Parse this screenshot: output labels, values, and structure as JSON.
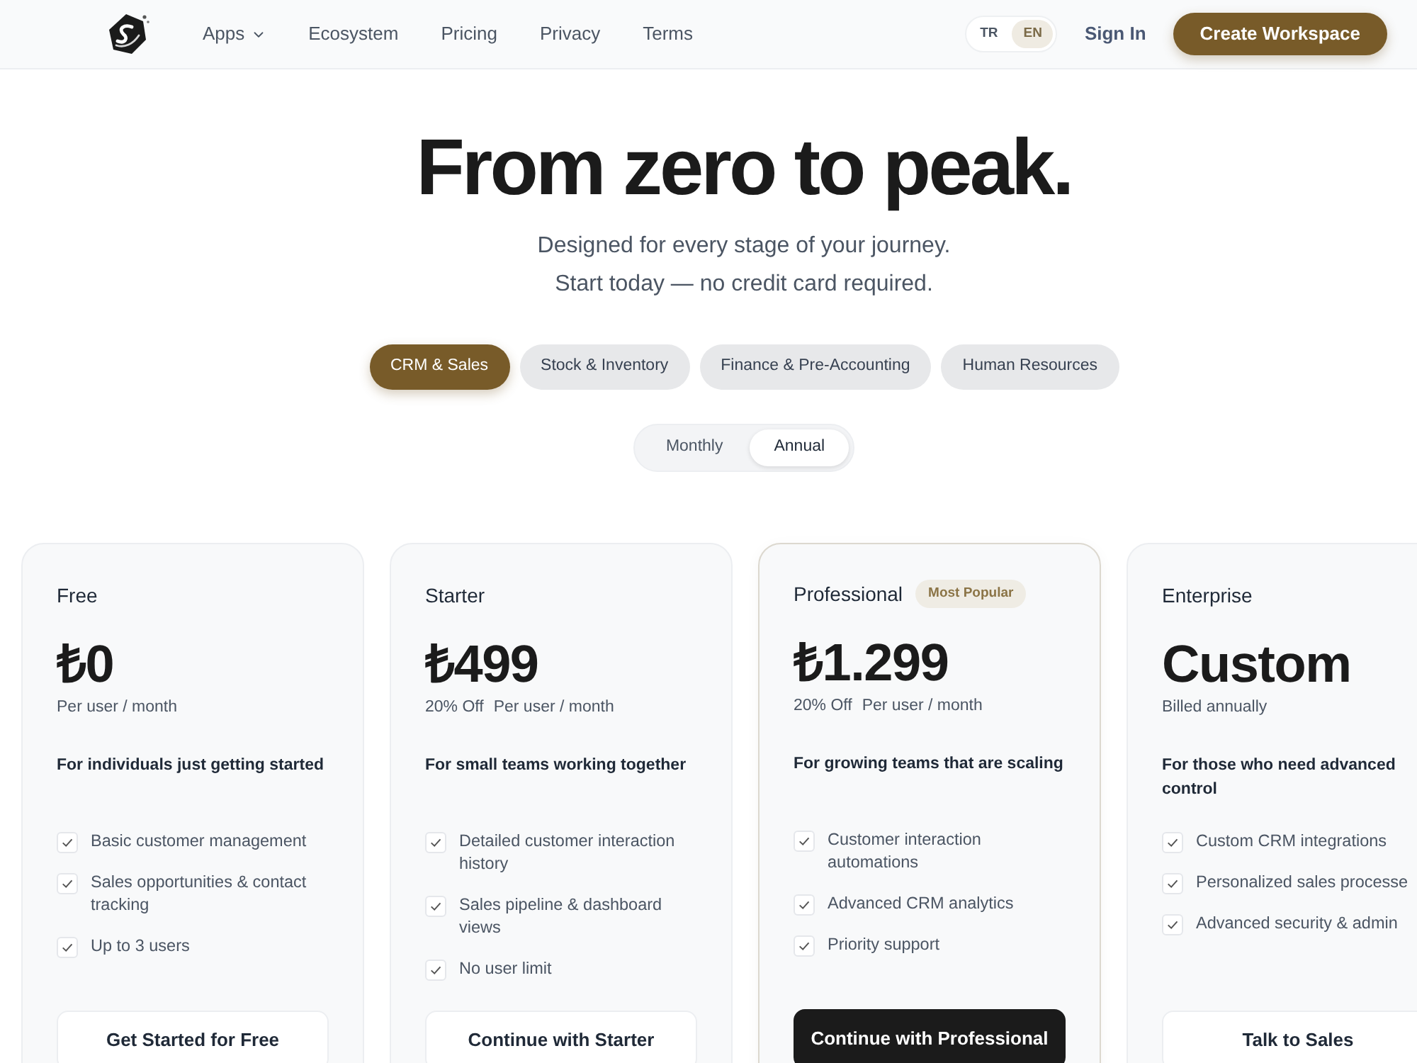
{
  "header": {
    "nav": [
      {
        "label": "Apps",
        "dropdown": true
      },
      {
        "label": "Ecosystem",
        "dropdown": false
      },
      {
        "label": "Pricing",
        "dropdown": false
      },
      {
        "label": "Privacy",
        "dropdown": false
      },
      {
        "label": "Terms",
        "dropdown": false
      }
    ],
    "languages": [
      {
        "label": "TR",
        "selected": false
      },
      {
        "label": "EN",
        "selected": true
      }
    ],
    "sign_in": "Sign In",
    "cta": "Create Workspace"
  },
  "hero": {
    "title": "From zero to peak.",
    "subtitle_lines": [
      "Designed for every stage of your journey.",
      "Start today — no credit card required."
    ]
  },
  "categories": [
    {
      "label": "CRM & Sales",
      "selected": true
    },
    {
      "label": "Stock & Inventory",
      "selected": false
    },
    {
      "label": "Finance & Pre-Accounting",
      "selected": false
    },
    {
      "label": "Human Resources",
      "selected": false
    }
  ],
  "billing": [
    {
      "label": "Monthly",
      "selected": false
    },
    {
      "label": "Annual",
      "selected": true
    }
  ],
  "plans": [
    {
      "name": "Free",
      "featured": false,
      "price": "₺0",
      "period": "Per user / month",
      "tagline": "For individuals just getting started",
      "features": [
        "Basic customer management",
        "Sales opportunities & contact tracking",
        "Up to 3 users"
      ],
      "button": "Get Started for Free"
    },
    {
      "name": "Starter",
      "featured": false,
      "price": "₺499",
      "discount": "20% Off",
      "period": "Per user / month",
      "tagline": "For small teams working together",
      "features": [
        "Detailed customer interaction history",
        "Sales pipeline & dashboard views",
        "No user limit"
      ],
      "button": "Continue with Starter"
    },
    {
      "name": "Professional",
      "featured": true,
      "badge": "Most Popular",
      "price": "₺1.299",
      "discount": "20% Off",
      "period": "Per user / month",
      "tagline": "For growing teams that are scaling",
      "features": [
        "Customer interaction automations",
        "Advanced CRM analytics",
        "Priority support"
      ],
      "button": "Continue with Professional"
    },
    {
      "name": "Enterprise",
      "featured": false,
      "price": "Custom",
      "period": "Billed annually",
      "tagline": "For those who need advanced control",
      "features": [
        "Custom CRM integrations",
        "Personalized sales processe",
        "Advanced security & admin"
      ],
      "button": "Talk to Sales"
    }
  ]
}
